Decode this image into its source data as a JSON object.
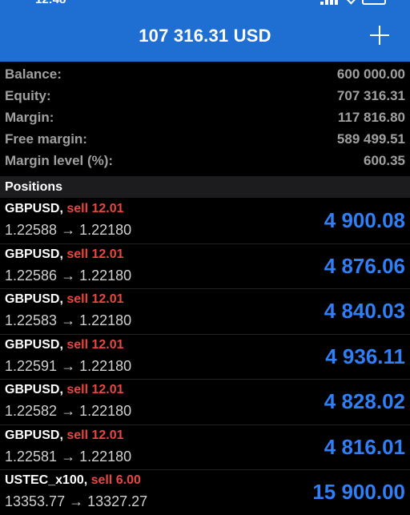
{
  "status": {
    "time": "12:48"
  },
  "header": {
    "title": "107 316.31 USD"
  },
  "summary": [
    {
      "label": "Balance:",
      "value": "600 000.00"
    },
    {
      "label": "Equity:",
      "value": "707 316.31"
    },
    {
      "label": "Margin:",
      "value": "117 816.80"
    },
    {
      "label": "Free margin:",
      "value": "589 499.51"
    },
    {
      "label": "Margin level (%):",
      "value": "600.35"
    }
  ],
  "positions_header": "Positions",
  "positions": [
    {
      "symbol": "GBPUSD,",
      "side": "sell 12.01",
      "prices": "1.22588 → 1.22180",
      "profit": "4 900.08"
    },
    {
      "symbol": "GBPUSD,",
      "side": "sell 12.01",
      "prices": "1.22586 → 1.22180",
      "profit": "4 876.06"
    },
    {
      "symbol": "GBPUSD,",
      "side": "sell 12.01",
      "prices": "1.22583 → 1.22180",
      "profit": "4 840.03"
    },
    {
      "symbol": "GBPUSD,",
      "side": "sell 12.01",
      "prices": "1.22591 → 1.22180",
      "profit": "4 936.11"
    },
    {
      "symbol": "GBPUSD,",
      "side": "sell 12.01",
      "prices": "1.22582 → 1.22180",
      "profit": "4 828.02"
    },
    {
      "symbol": "GBPUSD,",
      "side": "sell 12.01",
      "prices": "1.22581 → 1.22180",
      "profit": "4 816.01"
    },
    {
      "symbol": "USTEC_x100,",
      "side": "sell 6.00",
      "prices": "13353.77 → 13327.27",
      "profit": "15 900.00"
    }
  ],
  "colors": {
    "header_bg": "#1f6fd2",
    "sell": "#e8463f",
    "profit": "#2f7ff7"
  },
  "icons": {
    "add": "plus-icon"
  }
}
